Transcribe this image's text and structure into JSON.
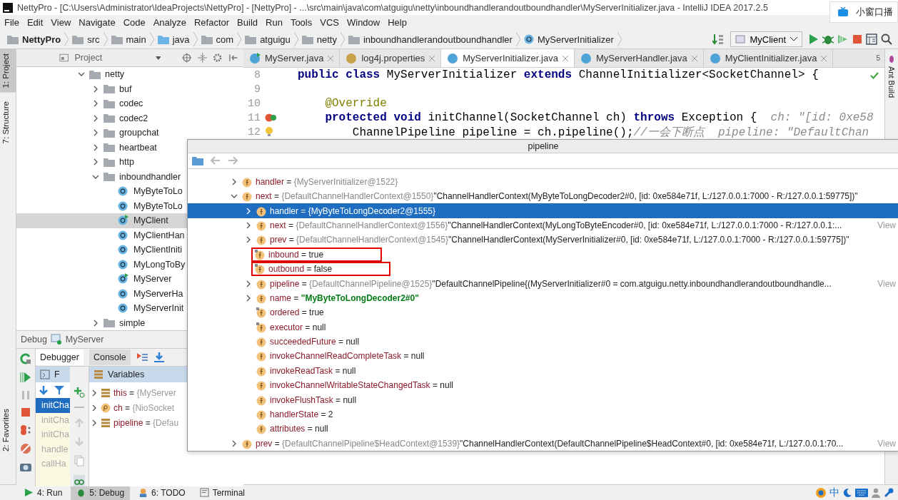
{
  "window": {
    "title": "NettyPro - [C:\\Users\\Administrator\\IdeaProjects\\NettyPro] - [NettyPro] - ...\\src\\main\\java\\com\\atguigu\\netty\\inboundhandlerandoutboundhandler\\MyServerInitializer.java - IntelliJ IDEA 2017.2.5"
  },
  "overlay": {
    "label": "小窗口播"
  },
  "menu": [
    "File",
    "Edit",
    "View",
    "Navigate",
    "Code",
    "Analyze",
    "Refactor",
    "Build",
    "Run",
    "Tools",
    "VCS",
    "Window",
    "Help"
  ],
  "breadcrumbs": [
    {
      "label": "NettyPro",
      "kind": "project"
    },
    {
      "label": "src",
      "kind": "folder"
    },
    {
      "label": "main",
      "kind": "folder"
    },
    {
      "label": "java",
      "kind": "source"
    },
    {
      "label": "com",
      "kind": "folder"
    },
    {
      "label": "atguigu",
      "kind": "folder"
    },
    {
      "label": "netty",
      "kind": "folder"
    },
    {
      "label": "inboundhandlerandoutboundhandler",
      "kind": "folder"
    },
    {
      "label": "MyServerInitializer",
      "kind": "class"
    }
  ],
  "run_config": {
    "label": "MyClient"
  },
  "left_stripe": [
    {
      "label": "1: Project",
      "selected": true
    },
    {
      "label": "7: Structure",
      "selected": false
    },
    {
      "label": "2: Favorites",
      "selected": false
    }
  ],
  "right_stripe": [
    {
      "label": "Ant Build"
    }
  ],
  "project_panel": {
    "title": "Project",
    "tree": [
      {
        "label": "netty",
        "kind": "folder",
        "selected": false,
        "expanded": true,
        "children": [
          {
            "label": "buf",
            "kind": "folder",
            "selected": false,
            "expanded": false
          },
          {
            "label": "codec",
            "kind": "folder",
            "selected": false,
            "expanded": false
          },
          {
            "label": "codec2",
            "kind": "folder",
            "selected": false,
            "expanded": false
          },
          {
            "label": "groupchat",
            "kind": "folder",
            "selected": false,
            "expanded": false
          },
          {
            "label": "heartbeat",
            "kind": "folder",
            "selected": false,
            "expanded": false
          },
          {
            "label": "http",
            "kind": "folder",
            "selected": false,
            "expanded": false
          },
          {
            "label": "inboundhandler",
            "kind": "folder",
            "selected": false,
            "expanded": true,
            "children": [
              {
                "label": "MyByteToLo",
                "kind": "class",
                "selected": false
              },
              {
                "label": "MyByteToLo",
                "kind": "class",
                "selected": false
              },
              {
                "label": "MyClient",
                "kind": "runnable",
                "selected": true
              },
              {
                "label": "MyClientHan",
                "kind": "class",
                "selected": false
              },
              {
                "label": "MyClientIniti",
                "kind": "class",
                "selected": false
              },
              {
                "label": "MyLongToBy",
                "kind": "class",
                "selected": false
              },
              {
                "label": "MyServer",
                "kind": "runnable",
                "selected": false
              },
              {
                "label": "MyServerHa",
                "kind": "class",
                "selected": false
              },
              {
                "label": "MyServerInit",
                "kind": "class",
                "selected": false
              }
            ]
          },
          {
            "label": "simple",
            "kind": "folder",
            "selected": false,
            "expanded": false
          }
        ]
      }
    ]
  },
  "editor": {
    "tabs": [
      {
        "label": "MyServer.java",
        "kind": "runnable",
        "selected": false
      },
      {
        "label": "log4j.properties",
        "kind": "properties",
        "selected": false
      },
      {
        "label": "MyServerInitializer.java",
        "kind": "class",
        "selected": true
      },
      {
        "label": "MyServerHandler.java",
        "kind": "class",
        "selected": false
      },
      {
        "label": "MyClientInitializer.java",
        "kind": "class",
        "selected": false
      }
    ],
    "hidden_tabs": "5",
    "lines": [
      {
        "number": "8",
        "kind": "plain",
        "segments": [
          {
            "kind": "keyword",
            "text": "public class "
          },
          {
            "kind": "plain",
            "text": "MyServerInitializer "
          },
          {
            "kind": "keyword",
            "text": "extends "
          },
          {
            "kind": "plain",
            "text": "ChannelInitializer<SocketChannel> {"
          }
        ]
      },
      {
        "number": "9",
        "kind": "plain"
      },
      {
        "number": "10",
        "kind": "plain",
        "segments": [
          {
            "kind": "annotation",
            "text": "    @Override"
          }
        ]
      },
      {
        "number": "11",
        "kind": "breakpoint",
        "segments": [
          {
            "kind": "keyword",
            "text": "    protected void "
          },
          {
            "kind": "plain",
            "text": "initChannel(SocketChannel ch) "
          },
          {
            "kind": "keyword",
            "text": "throws "
          },
          {
            "kind": "plain",
            "text": "Exception {  "
          },
          {
            "kind": "hint",
            "text": "ch: \"[id: 0xe58"
          }
        ]
      },
      {
        "number": "12",
        "kind": "bulb",
        "segments": [
          {
            "kind": "plain",
            "text": "        ChannelPipeline pipeline = ch.pipeline();"
          },
          {
            "kind": "comment",
            "text": "//一会下断点  "
          },
          {
            "kind": "hint",
            "text": "pipeline: \"DefaultChan"
          }
        ]
      }
    ]
  },
  "debug": {
    "title": "Debug",
    "config": "MyServer",
    "tabs": [
      {
        "label": "Debugger",
        "selected": true
      },
      {
        "label": "Console",
        "selected": false
      }
    ],
    "frames_header": "F",
    "frames": [
      {
        "label": "initCha",
        "selected": true
      },
      {
        "label": "initCha",
        "selected": false
      },
      {
        "label": "initCha",
        "selected": false
      },
      {
        "label": "handle",
        "selected": false
      },
      {
        "label": "callHa",
        "selected": false
      }
    ],
    "variables_header": "Variables",
    "variables": [
      {
        "name": "this",
        "eq": "=",
        "value": "{MyServer",
        "kind": "object"
      },
      {
        "name": "ch",
        "eq": "=",
        "value": "{NioSocket",
        "kind": "param"
      },
      {
        "name": "pipeline",
        "eq": "=",
        "value": "{Defau",
        "kind": "object"
      }
    ]
  },
  "popup": {
    "title": "pipeline",
    "rows": [
      {
        "name": "handler",
        "eq": "=",
        "type": "{MyServerInitializer@1522}",
        "expandable": true,
        "expanded": false,
        "selected": false
      },
      {
        "name": "next",
        "eq": "=",
        "type": "{DefaultChannelHandlerContext@1550}",
        "summary": "\"ChannelHandlerContext(MyByteToLongDecoder2#0, [id: 0xe584e71f, L:/127.0.0.1:7000 - R:/127.0.0.1:59775])\"",
        "expandable": true,
        "expanded": true,
        "selected": false,
        "children": [
          {
            "name": "handler",
            "eq": "=",
            "value": "{MyByteToLongDecoder2@1555}",
            "expandable": true,
            "expanded": false,
            "selected": true
          },
          {
            "name": "next",
            "eq": "=",
            "type": "{DefaultChannelHandlerContext@1556}",
            "summary": "\"ChannelHandlerContext(MyLongToByteEncoder#0, [id: 0xe584e71f, L:/127.0.0.1:7000 - R:/127.0.0.1:...",
            "view": "View",
            "expandable": true,
            "expanded": false,
            "selected": false
          },
          {
            "name": "prev",
            "eq": "=",
            "type": "{DefaultChannelHandlerContext@1545}",
            "summary": "\"ChannelHandlerContext(MyServerInitializer#0, [id: 0xe584e71f, L:/127.0.0.1:7000 - R:/127.0.0.1:59775])\"",
            "expandable": true,
            "expanded": false,
            "selected": false
          },
          {
            "name": "inbound",
            "eq": "=",
            "value": "true",
            "final": true,
            "highlight": true,
            "selected": false
          },
          {
            "name": "outbound",
            "eq": "=",
            "value": "false",
            "final": true,
            "highlight": true,
            "selected": false
          },
          {
            "name": "pipeline",
            "eq": "=",
            "type": "{DefaultChannelPipeline@1525}",
            "summary": "\"DefaultChannelPipeline{(MyServerInitializer#0 = com.atguigu.netty.inboundhandlerandoutboundhandle...",
            "view": "View",
            "expandable": true,
            "expanded": false,
            "selected": false
          },
          {
            "name": "name",
            "eq": "=",
            "string": "\"MyByteToLongDecoder2#0\"",
            "expandable": true,
            "expanded": false,
            "selected": false
          },
          {
            "name": "ordered",
            "eq": "=",
            "value": "true",
            "final": true,
            "selected": false
          },
          {
            "name": "executor",
            "eq": "=",
            "value": "null",
            "final": true,
            "selected": false
          },
          {
            "name": "succeededFuture",
            "eq": "=",
            "value": "null",
            "selected": false
          },
          {
            "name": "invokeChannelReadCompleteTask",
            "eq": "=",
            "value": "null",
            "selected": false
          },
          {
            "name": "invokeReadTask",
            "eq": "=",
            "value": "null",
            "selected": false
          },
          {
            "name": "invokeChannelWritableStateChangedTask",
            "eq": "=",
            "value": "null",
            "selected": false
          },
          {
            "name": "invokeFlushTask",
            "eq": "=",
            "value": "null",
            "selected": false
          },
          {
            "name": "handlerState",
            "eq": "=",
            "value": "2",
            "selected": false
          },
          {
            "name": "attributes",
            "eq": "=",
            "value": "null",
            "selected": false
          }
        ]
      },
      {
        "name": "prev",
        "eq": "=",
        "type": "{DefaultChannelPipeline$HeadContext@1539}",
        "summary": "\"ChannelHandlerContext(DefaultChannelPipeline$HeadContext#0, [id: 0xe584e71f, L:/127.0.0.1:70...",
        "view": "View",
        "expandable": true,
        "expanded": false,
        "selected": false
      }
    ]
  },
  "bottom_tabs": [
    {
      "label": "4: Run",
      "kind": "run",
      "selected": false
    },
    {
      "label": "5: Debug",
      "kind": "debug",
      "selected": true
    },
    {
      "label": "6: TODO",
      "kind": "todo",
      "selected": false
    },
    {
      "label": "Terminal",
      "kind": "terminal",
      "selected": false
    }
  ],
  "tray": {
    "ime": "中"
  }
}
